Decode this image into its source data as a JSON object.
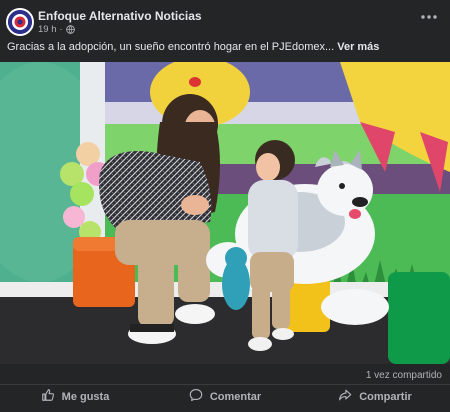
{
  "post": {
    "author": "Enfoque Alternativo Noticias",
    "time": "19 h",
    "separator": "·",
    "caption": "Gracias a la adopción, un sueño encontró hogar en el PJEdomex...",
    "see_more": "Ver más"
  },
  "stats": {
    "shares": "1 vez compartido"
  },
  "actions": {
    "like": "Me gusta",
    "comment": "Comentar",
    "share": "Compartir"
  },
  "colors": {
    "background": "#242526",
    "text": "#e4e6eb",
    "muted": "#b0b3b8"
  },
  "icons": [
    "globe-icon",
    "more-options-icon",
    "like-icon",
    "comment-icon",
    "share-icon"
  ]
}
